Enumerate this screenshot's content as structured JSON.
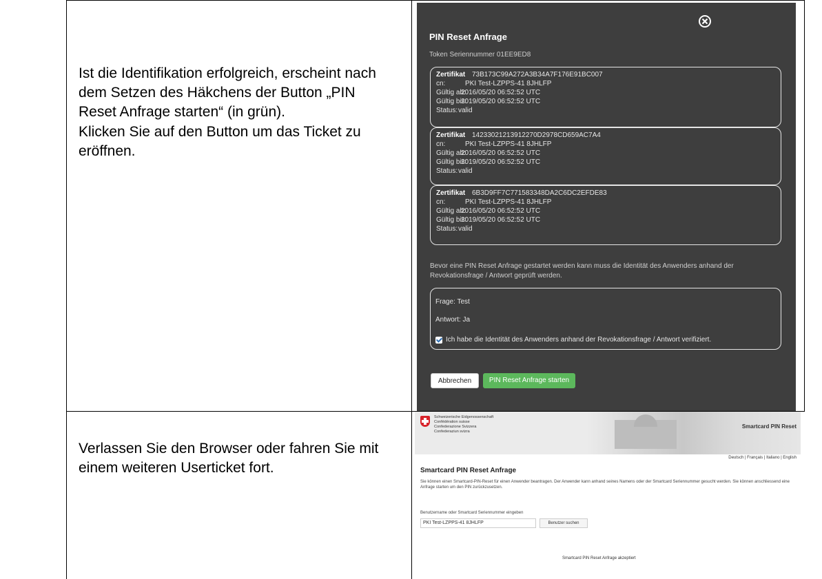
{
  "instructions": {
    "row1_p1": "Ist die Identifikation erfolgreich, erscheint nach dem Setzen des Häkchens der Button „PIN Reset Anfrage starten“ (in grün).",
    "row1_p2": "Klicken Sie auf den Button um das Ticket zu eröffnen.",
    "row2_p1": "Verlassen Sie den Browser oder fahren Sie mit einem weiteren Userticket fort."
  },
  "modal": {
    "close_icon": "close-circle-icon",
    "close_glyph": "×",
    "title": "PIN Reset Anfrage",
    "token": "Token Seriennummer 01EE9ED8",
    "certificates": [
      {
        "head_label": "Zertifikat",
        "serial": "73B173C99A272A3B34A7F176E91BC007",
        "cn_label": "cn:",
        "cn": "PKI Test-LZPPS-41 8JHLFP",
        "from_label": "Gültig ab:",
        "from": "2016/05/20 06:52:52 UTC",
        "to_label": "Gültig bis:",
        "to": "2019/05/20 06:52:52 UTC",
        "status_label": "Status:",
        "status": "valid"
      },
      {
        "head_label": "Zertifikat",
        "serial": "14233021213912270D2978CD659AC7A4",
        "cn_label": "cn:",
        "cn": "PKI Test-LZPPS-41 8JHLFP",
        "from_label": "Gültig ab:",
        "from": "2016/05/20 06:52:52 UTC",
        "to_label": "Gültig bis:",
        "to": "2019/05/20 06:52:52 UTC",
        "status_label": "Status:",
        "status": "valid"
      },
      {
        "head_label": "Zertifikat",
        "serial": "6B3D9FF7C771583348DA2C6DC2EFDE83",
        "cn_label": "cn:",
        "cn": "PKI Test-LZPPS-41 8JHLFP",
        "from_label": "Gültig ab:",
        "from": "2016/05/20 06:52:52 UTC",
        "to_label": "Gültig bis:",
        "to": "2019/05/20 06:52:52 UTC",
        "status_label": "Status:",
        "status": "valid"
      }
    ],
    "notice": "Bevor eine PIN Reset Anfrage gestartet werden kann muss die Identität des Anwenders anhand der Revokationsfrage / Antwort geprüft werden.",
    "question": "Frage: Test",
    "answer": "Antwort: Ja",
    "checkbox_checked": true,
    "checkbox_label": "Ich habe die Identität des Anwenders anhand der Revokationsfrage / Antwort verifiziert.",
    "cancel_label": "Abbrechen",
    "start_label": "PIN Reset Anfrage starten",
    "start_color": "#5cb85c",
    "background_color": "#3e3e3e"
  },
  "page2": {
    "confederation": {
      "line1": "Schweizerische Eidgenossenschaft",
      "line2": "Confédération suisse",
      "line3": "Confederazione Svizzera",
      "line4": "Confederaziun svizra"
    },
    "app_name": "Smartcard PIN Reset",
    "languages": "Deutsch | Français | Italiano | English",
    "title": "Smartcard PIN Reset Anfrage",
    "description": "Sie können einen Smartcard-PIN-Reset für einen Anwender beantragen. Der Anwender kann anhand seines Namens oder der Smartcard Seriennummer gesucht werden. Sie können anschliessend eine Anfrage starten um den PIN zurückzusetzen.",
    "search_label": "Benutzername oder Smartcard Seriennummer eingeben",
    "search_value": "PKI Test-LZPPS-41 8JHLFP",
    "search_button": "Benutzer suchen",
    "confirmation": "Smartcard PIN Reset Anfrage akzeptiert"
  }
}
